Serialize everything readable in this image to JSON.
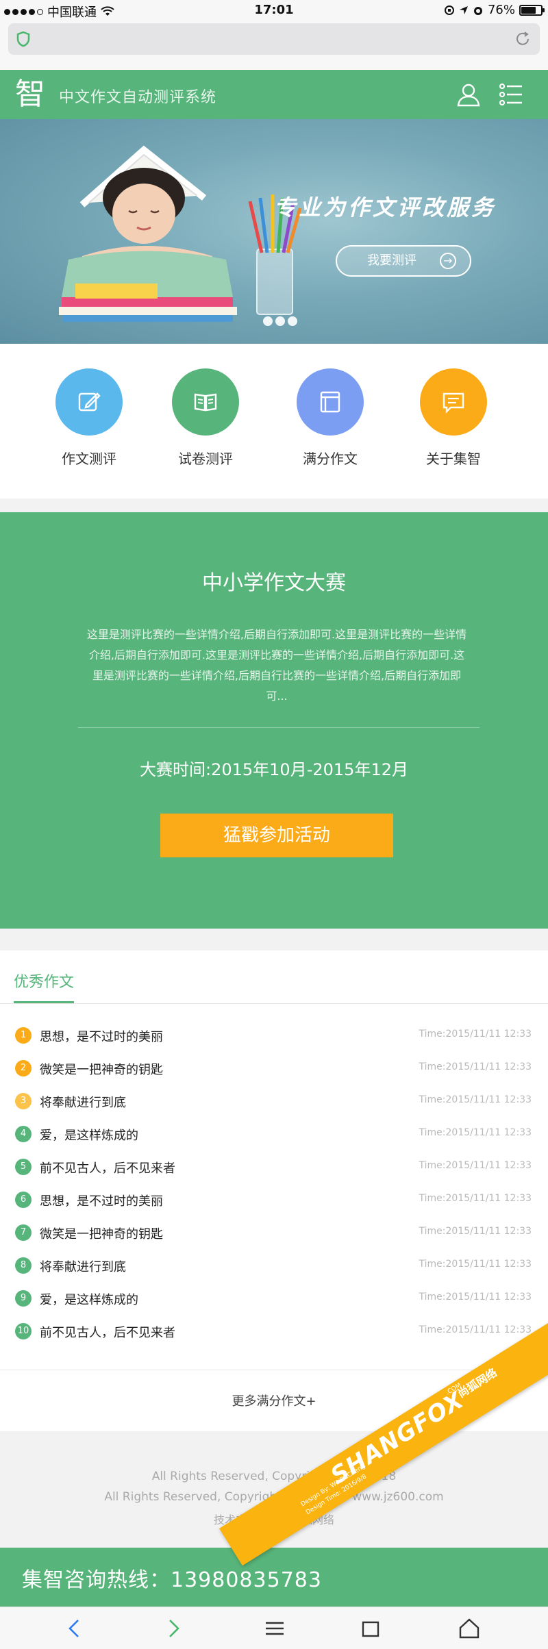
{
  "status_bar": {
    "carrier": "中国联通",
    "time": "17:01",
    "battery": "76%",
    "battery_level": 0.76
  },
  "header": {
    "logo": "智",
    "title": "中文作文自动测评系统"
  },
  "banner": {
    "slogan": "专业为作文评改服务",
    "cta_label": "我要测评",
    "slides": 3
  },
  "quick_nav": [
    {
      "label": "作文测评",
      "icon": "pencil-edit-icon",
      "color": "#5bb8ec"
    },
    {
      "label": "试卷测评",
      "icon": "open-book-icon",
      "color": "#57b47a"
    },
    {
      "label": "满分作文",
      "icon": "document-icon",
      "color": "#7b9ef2"
    },
    {
      "label": "关于集智",
      "icon": "message-icon",
      "color": "#fbab17"
    }
  ],
  "contest": {
    "title": "中小学作文大赛",
    "description": "这里是测评比赛的一些详情介绍,后期自行添加即可.这里是测评比赛的一些详情介绍,后期自行添加即可.这里是测评比赛的一些详情介绍,后期自行添加即可.这里是测评比赛的一些详情介绍,后期自行比赛的一些详情介绍,后期自行添加即可...",
    "period": "大赛时间:2015年10月-2015年12月",
    "join_label": "猛戳参加活动"
  },
  "essays": {
    "tab_label": "优秀作文",
    "items": [
      {
        "num": "1",
        "title": "思想，是不过时的美丽",
        "time": "Time:2015/11/11 12:33",
        "color": "#fbab17"
      },
      {
        "num": "2",
        "title": "微笑是一把神奇的钥匙",
        "time": "Time:2015/11/11 12:33",
        "color": "#fbab17"
      },
      {
        "num": "3",
        "title": "将奉献进行到底",
        "time": "Time:2015/11/11 12:33",
        "color": "#fbc34a"
      },
      {
        "num": "4",
        "title": "爱，是这样炼成的",
        "time": "Time:2015/11/11 12:33",
        "color": "#57b47a"
      },
      {
        "num": "5",
        "title": "前不见古人，后不见来者",
        "time": "Time:2015/11/11 12:33",
        "color": "#57b47a"
      },
      {
        "num": "6",
        "title": "思想，是不过时的美丽",
        "time": "Time:2015/11/11 12:33",
        "color": "#57b47a"
      },
      {
        "num": "7",
        "title": "微笑是一把神奇的钥匙",
        "time": "Time:2015/11/11 12:33",
        "color": "#57b47a"
      },
      {
        "num": "8",
        "title": "将奉献进行到底",
        "time": "Time:2015/11/11 12:33",
        "color": "#57b47a"
      },
      {
        "num": "9",
        "title": "爱，是这样炼成的",
        "time": "Time:2015/11/11 12:33",
        "color": "#57b47a"
      },
      {
        "num": "10",
        "title": "前不见古人，后不见来者",
        "time": "Time:2015/11/11 12:33",
        "color": "#57b47a"
      }
    ],
    "more_label": "更多满分作文+"
  },
  "footer": {
    "line1": "All Rights Reserved, Copyright 2015-2018",
    "line2": "All Rights Reserved, Copyright 2015-2018 www.jz600.com",
    "line3": "技术支持：四川尚狐网络"
  },
  "hotline": {
    "text": "集智咨询热线：13980835783"
  },
  "watermark": {
    "brand": "SHANGFOX",
    "brand_cn": "尚狐网络",
    "domain": ".COM",
    "designer": "Design By: WeiDuCheng",
    "date": "Design Time: 2016/9/8"
  },
  "colors": {
    "primary": "#57b47a",
    "accent": "#fbab17"
  }
}
